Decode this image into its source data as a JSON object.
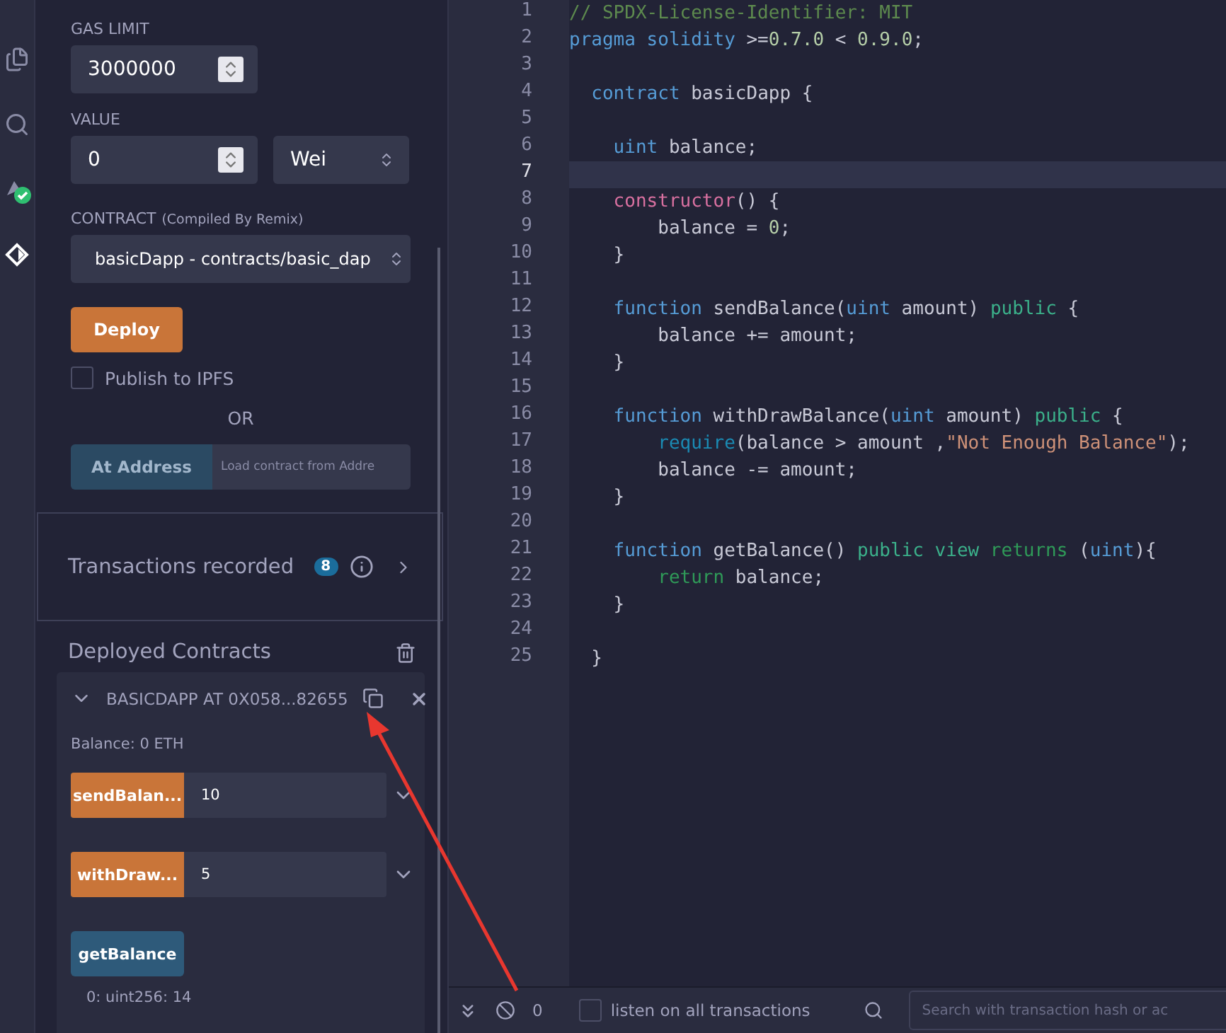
{
  "sidebar": {
    "icons": [
      {
        "kind": "files",
        "selected": false
      },
      {
        "kind": "search",
        "selected": false
      },
      {
        "kind": "compiler",
        "selected": false
      },
      {
        "kind": "deploy",
        "selected": true
      }
    ]
  },
  "deploy_panel": {
    "gas_limit": {
      "label": "GAS LIMIT",
      "value": "3000000"
    },
    "value": {
      "label": "VALUE",
      "value": "0",
      "unit": "Wei"
    },
    "contract": {
      "label": "CONTRACT",
      "note": "(Compiled By Remix)",
      "value": "basicDapp - contracts/basic_dap"
    },
    "deploy_button": "Deploy",
    "publish": {
      "label": "Publish to IPFS",
      "checked": false
    },
    "or": "OR",
    "at_address": {
      "button": "At Address",
      "placeholder": "Load contract from Addre"
    },
    "transactions": {
      "label": "Transactions recorded",
      "count": "8"
    },
    "deployed": {
      "title": "Deployed Contracts",
      "instance": {
        "title": "BASICDAPP AT 0X058...82655",
        "expanded": true,
        "balance": "Balance: 0 ETH",
        "functions": [
          {
            "kind": "transact",
            "name": "sendBalan...",
            "value": "10"
          },
          {
            "kind": "transact",
            "name": "withDraw...",
            "value": "5"
          },
          {
            "kind": "call",
            "name": "getBalance",
            "result": "0: uint256: 14"
          }
        ]
      }
    }
  },
  "editor": {
    "lines": [
      {
        "number": "1",
        "current": false,
        "tokens": [
          {
            "kind": "comment",
            "text": "// SPDX-License-Identifier: MIT"
          }
        ]
      },
      {
        "number": "2",
        "current": false,
        "tokens": [
          {
            "kind": "keyword",
            "text": "pragma solidity"
          },
          {
            "kind": "plain",
            "text": " >="
          },
          {
            "kind": "number",
            "text": "0.7.0"
          },
          {
            "kind": "plain",
            "text": " < "
          },
          {
            "kind": "number",
            "text": "0.9.0"
          },
          {
            "kind": "plain",
            "text": ";"
          }
        ]
      },
      {
        "number": "3",
        "current": false
      },
      {
        "number": "4",
        "current": false,
        "tokens": [
          {
            "kind": "keyword",
            "text": "  contract"
          },
          {
            "kind": "plain",
            "text": " basicDapp {"
          }
        ]
      },
      {
        "number": "5",
        "current": false
      },
      {
        "number": "6",
        "current": false,
        "tokens": [
          {
            "kind": "keyword",
            "text": "    uint"
          },
          {
            "kind": "plain",
            "text": " balance;"
          }
        ]
      },
      {
        "number": "7",
        "current": true
      },
      {
        "number": "8",
        "current": false,
        "tokens": [
          {
            "kind": "ctor",
            "text": "    constructor"
          },
          {
            "kind": "plain",
            "text": "() {"
          }
        ]
      },
      {
        "number": "9",
        "current": false,
        "tokens": [
          {
            "kind": "plain",
            "text": "        balance = "
          },
          {
            "kind": "number",
            "text": "0"
          },
          {
            "kind": "plain",
            "text": ";"
          }
        ]
      },
      {
        "number": "10",
        "current": false,
        "tokens": [
          {
            "kind": "plain",
            "text": "    }"
          }
        ]
      },
      {
        "number": "11",
        "current": false
      },
      {
        "number": "12",
        "current": false,
        "tokens": [
          {
            "kind": "keyword",
            "text": "    function"
          },
          {
            "kind": "plain",
            "text": " sendBalance("
          },
          {
            "kind": "keyword",
            "text": "uint"
          },
          {
            "kind": "plain",
            "text": " amount) "
          },
          {
            "kind": "modifier",
            "text": "public"
          },
          {
            "kind": "plain",
            "text": " {"
          }
        ]
      },
      {
        "number": "13",
        "current": false,
        "tokens": [
          {
            "kind": "plain",
            "text": "        balance += amount;"
          }
        ]
      },
      {
        "number": "14",
        "current": false,
        "tokens": [
          {
            "kind": "plain",
            "text": "    }"
          }
        ]
      },
      {
        "number": "15",
        "current": false
      },
      {
        "number": "16",
        "current": false,
        "tokens": [
          {
            "kind": "keyword",
            "text": "    function"
          },
          {
            "kind": "plain",
            "text": " withDrawBalance("
          },
          {
            "kind": "keyword",
            "text": "uint"
          },
          {
            "kind": "plain",
            "text": " amount) "
          },
          {
            "kind": "modifier",
            "text": "public"
          },
          {
            "kind": "plain",
            "text": " {"
          }
        ]
      },
      {
        "number": "17",
        "current": false,
        "tokens": [
          {
            "kind": "builtin",
            "text": "        require"
          },
          {
            "kind": "plain",
            "text": "(balance > amount ,"
          },
          {
            "kind": "string",
            "text": "\"Not Enough Balance\""
          },
          {
            "kind": "plain",
            "text": ");"
          }
        ]
      },
      {
        "number": "18",
        "current": false,
        "tokens": [
          {
            "kind": "plain",
            "text": "        balance -= amount;"
          }
        ]
      },
      {
        "number": "19",
        "current": false,
        "tokens": [
          {
            "kind": "plain",
            "text": "    }"
          }
        ]
      },
      {
        "number": "20",
        "current": false
      },
      {
        "number": "21",
        "current": false,
        "tokens": [
          {
            "kind": "keyword",
            "text": "    function"
          },
          {
            "kind": "plain",
            "text": " getBalance() "
          },
          {
            "kind": "modifier",
            "text": "public view"
          },
          {
            "kind": "control",
            "text": " returns"
          },
          {
            "kind": "plain",
            "text": " ("
          },
          {
            "kind": "keyword",
            "text": "uint"
          },
          {
            "kind": "plain",
            "text": "){"
          }
        ]
      },
      {
        "number": "22",
        "current": false,
        "tokens": [
          {
            "kind": "control",
            "text": "        return"
          },
          {
            "kind": "plain",
            "text": " balance;"
          }
        ]
      },
      {
        "number": "23",
        "current": false,
        "tokens": [
          {
            "kind": "plain",
            "text": "    }"
          }
        ]
      },
      {
        "number": "24",
        "current": false
      },
      {
        "number": "25",
        "current": false,
        "tokens": [
          {
            "kind": "plain",
            "text": "  }"
          }
        ]
      }
    ]
  },
  "terminal": {
    "count": "0",
    "listen": {
      "label": "listen on all transactions",
      "checked": false
    },
    "search": {
      "placeholder": "Search with transaction hash or ac"
    }
  }
}
